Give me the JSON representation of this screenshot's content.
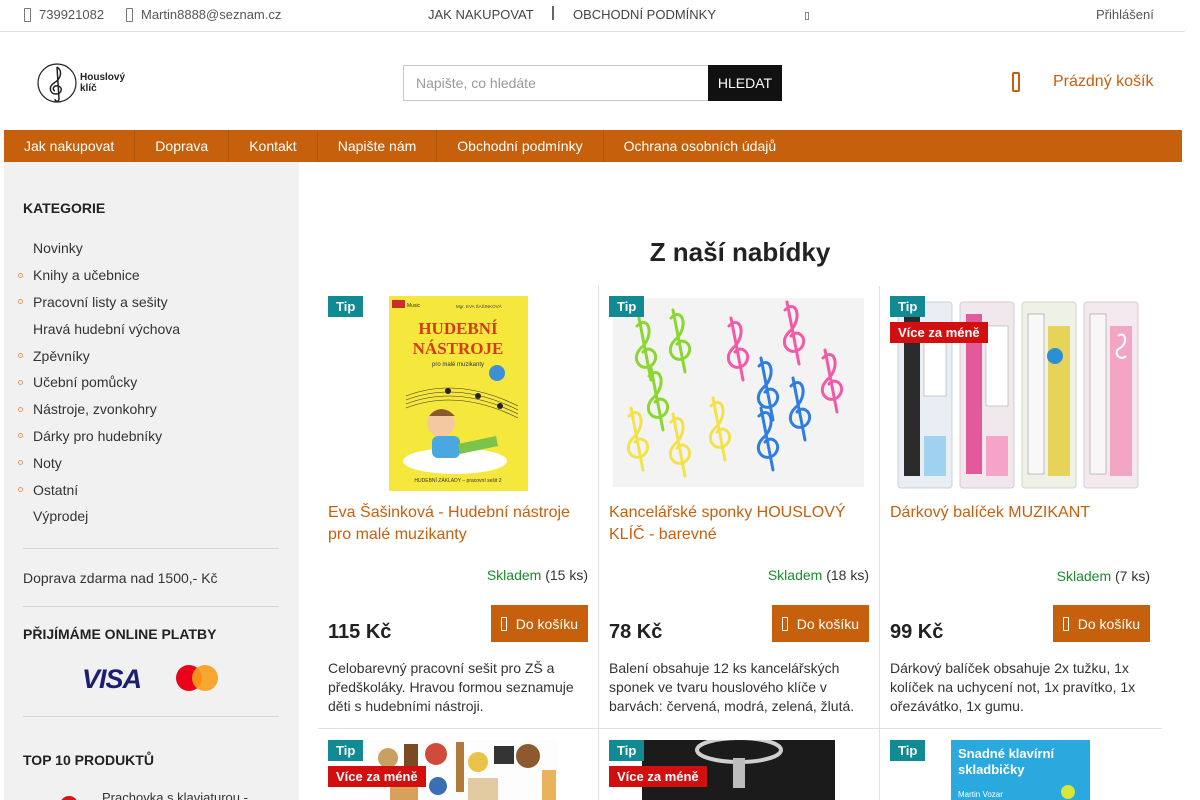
{
  "topbar": {
    "phone": "739921082",
    "email": "Martin8888@seznam.cz",
    "links": [
      "JAK NAKUPOVAT",
      "OBCHODNÍ PODMÍNKY"
    ],
    "login": "Přihlášení"
  },
  "header": {
    "logo_line1": "Houslový",
    "logo_line2": "klíč",
    "search_placeholder": "Napište, co hledáte",
    "search_button": "HLEDAT",
    "cart_label": "Prázdný košík"
  },
  "nav": [
    "Jak nakupovat",
    "Doprava",
    "Kontakt",
    "Napište nám",
    "Obchodní podmínky",
    "Ochrana osobních údajů"
  ],
  "sidebar": {
    "categories_title": "KATEGORIE",
    "categories": [
      {
        "label": "Novinky",
        "bullet": false
      },
      {
        "label": "Knihy a učebnice",
        "bullet": true
      },
      {
        "label": "Pracovní listy a sešity",
        "bullet": true
      },
      {
        "label": "Hravá hudební výchova",
        "bullet": false
      },
      {
        "label": "Zpěvníky",
        "bullet": true
      },
      {
        "label": "Učební pomůcky",
        "bullet": true
      },
      {
        "label": "Nástroje, zvonkohry",
        "bullet": true
      },
      {
        "label": "Dárky pro hudebníky",
        "bullet": true
      },
      {
        "label": "Noty",
        "bullet": true
      },
      {
        "label": "Ostatní",
        "bullet": true
      },
      {
        "label": "Výprodej",
        "bullet": false
      }
    ],
    "shipping_note": "Doprava zdarma nad 1500,- Kč",
    "payments_title": "PŘIJÍMÁME ONLINE PLATBY",
    "visa": "VISA",
    "top10_title": "TOP 10 PRODUKTŮ",
    "top10_first": "Prachovka s klaviaturou -"
  },
  "main": {
    "title": "Z naší nabídky",
    "badge_tip": "Tip",
    "badge_sale": "Více za méně",
    "button_label": "Do košíku",
    "stock_label": "Skladem",
    "products": [
      {
        "name": "Eva Šašinková - Hudební nástroje pro malé muzikanty",
        "stock": "(15 ks)",
        "price": "115 Kč",
        "description": "Celobarevný pracovní sešit pro ZŠ a předškoláky. Hravou formou seznamuje děti s hudebními nástroji.",
        "book_title_1": "HUDEBNÍ",
        "book_title_2": "NÁSTROJE",
        "book_sub": "pro malé muzikanty",
        "book_author": "Mgr. EVA ŠAŠINKOVÁ",
        "book_footer": "HUDEBNÍ ZÁKLADY – pracovní sešit 2",
        "book_brand": "Music"
      },
      {
        "name": "Kancelářské sponky HOUSLOVÝ KLÍČ - barevné",
        "stock": "(18 ks)",
        "price": "78 Kč",
        "description": "Balení obsahuje 12 ks kancelářských sponek ve tvaru houslového klíče v barvách: červená, modrá, zelená, žlutá."
      },
      {
        "name": "Dárkový balíček MUZIKANT",
        "stock": "(7 ks)",
        "price": "99 Kč",
        "description": "Dárkový balíček obsahuje 2x tužku, 1x kolíček na uchycení not, 1x pravítko, 1x ořezávátko, 1x gumu."
      }
    ],
    "row2_book_title_1": "Snadné klavírní",
    "row2_book_title_2": "skladbičky",
    "row2_book_author": "Martin Vozar"
  },
  "colors": {
    "accent": "#c7600c",
    "tip_badge": "#118a94",
    "sale_badge": "#d10f0f",
    "in_stock": "#1a8c2a"
  },
  "icons": [
    "phone-icon",
    "mail-icon",
    "cart-icon",
    "bag-icon"
  ]
}
